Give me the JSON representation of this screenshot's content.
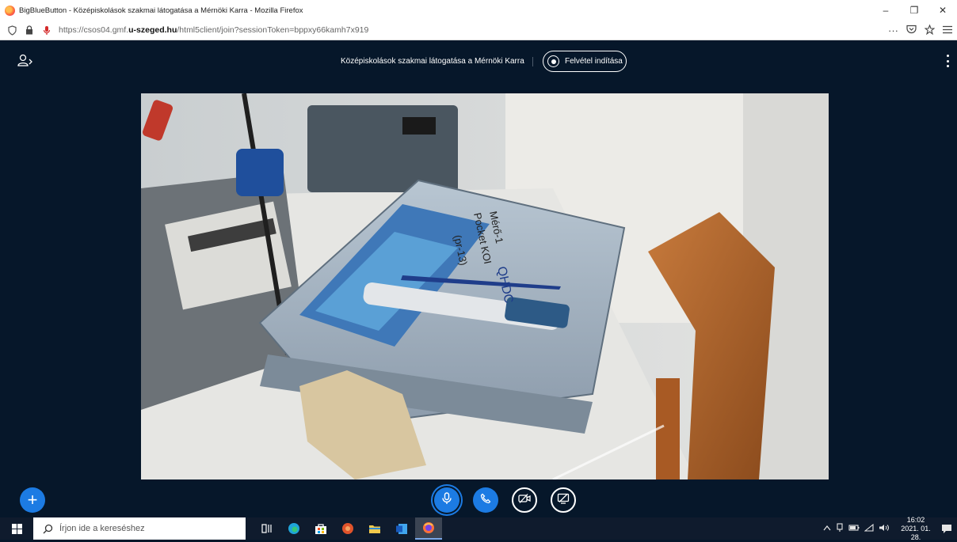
{
  "browser": {
    "window_title": "BigBlueButton - Középiskolások szakmai látogatása a Mérnöki Karra - Mozilla Firefox",
    "url_prefix": "https://csos04.gmf.",
    "url_domain": "u-szeged.hu",
    "url_path": "/html5client/join?sessionToken=bppxy66kamh7x919",
    "win_minimize": "–",
    "win_maximize": "❐",
    "win_close": "✕",
    "more_glyph": "···"
  },
  "meeting": {
    "title": "Középiskolások szakmai látogatása a Mérnöki Karra",
    "record_label": "Felvétel indítása"
  },
  "controls": {
    "actions_label": "+"
  },
  "video_labels": {
    "line1": "Mérő-1",
    "line2": "Pocket KOI",
    "line3": "(pr-13)",
    "line4": "QHDC"
  },
  "taskbar": {
    "search_placeholder": "Írjon ide a kereséshez",
    "time": "16:02",
    "date": "2021. 01. 28."
  },
  "colors": {
    "accent": "#1c7be3",
    "app_bg": "#06172a",
    "taskbar_bg": "#0f1b2d"
  }
}
